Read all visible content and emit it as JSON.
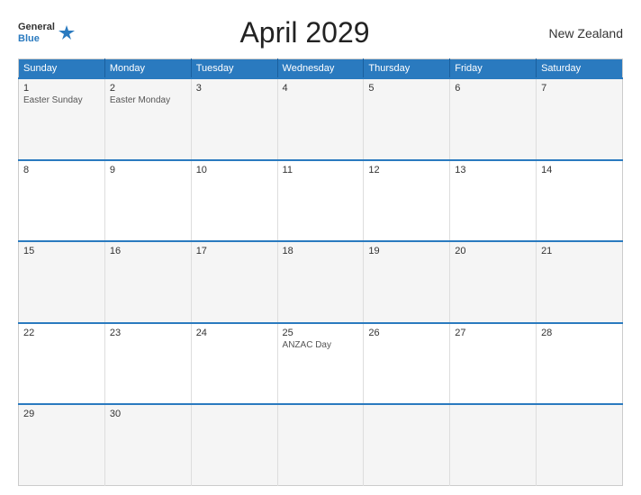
{
  "header": {
    "logo_general": "General",
    "logo_blue": "Blue",
    "title": "April 2029",
    "country": "New Zealand"
  },
  "calendar": {
    "days": [
      "Sunday",
      "Monday",
      "Tuesday",
      "Wednesday",
      "Thursday",
      "Friday",
      "Saturday"
    ],
    "weeks": [
      [
        {
          "num": "1",
          "holiday": "Easter Sunday"
        },
        {
          "num": "2",
          "holiday": "Easter Monday"
        },
        {
          "num": "3",
          "holiday": ""
        },
        {
          "num": "4",
          "holiday": ""
        },
        {
          "num": "5",
          "holiday": ""
        },
        {
          "num": "6",
          "holiday": ""
        },
        {
          "num": "7",
          "holiday": ""
        }
      ],
      [
        {
          "num": "8",
          "holiday": ""
        },
        {
          "num": "9",
          "holiday": ""
        },
        {
          "num": "10",
          "holiday": ""
        },
        {
          "num": "11",
          "holiday": ""
        },
        {
          "num": "12",
          "holiday": ""
        },
        {
          "num": "13",
          "holiday": ""
        },
        {
          "num": "14",
          "holiday": ""
        }
      ],
      [
        {
          "num": "15",
          "holiday": ""
        },
        {
          "num": "16",
          "holiday": ""
        },
        {
          "num": "17",
          "holiday": ""
        },
        {
          "num": "18",
          "holiday": ""
        },
        {
          "num": "19",
          "holiday": ""
        },
        {
          "num": "20",
          "holiday": ""
        },
        {
          "num": "21",
          "holiday": ""
        }
      ],
      [
        {
          "num": "22",
          "holiday": ""
        },
        {
          "num": "23",
          "holiday": ""
        },
        {
          "num": "24",
          "holiday": ""
        },
        {
          "num": "25",
          "holiday": "ANZAC Day"
        },
        {
          "num": "26",
          "holiday": ""
        },
        {
          "num": "27",
          "holiday": ""
        },
        {
          "num": "28",
          "holiday": ""
        }
      ],
      [
        {
          "num": "29",
          "holiday": ""
        },
        {
          "num": "30",
          "holiday": ""
        },
        {
          "num": "",
          "holiday": ""
        },
        {
          "num": "",
          "holiday": ""
        },
        {
          "num": "",
          "holiday": ""
        },
        {
          "num": "",
          "holiday": ""
        },
        {
          "num": "",
          "holiday": ""
        }
      ]
    ]
  }
}
